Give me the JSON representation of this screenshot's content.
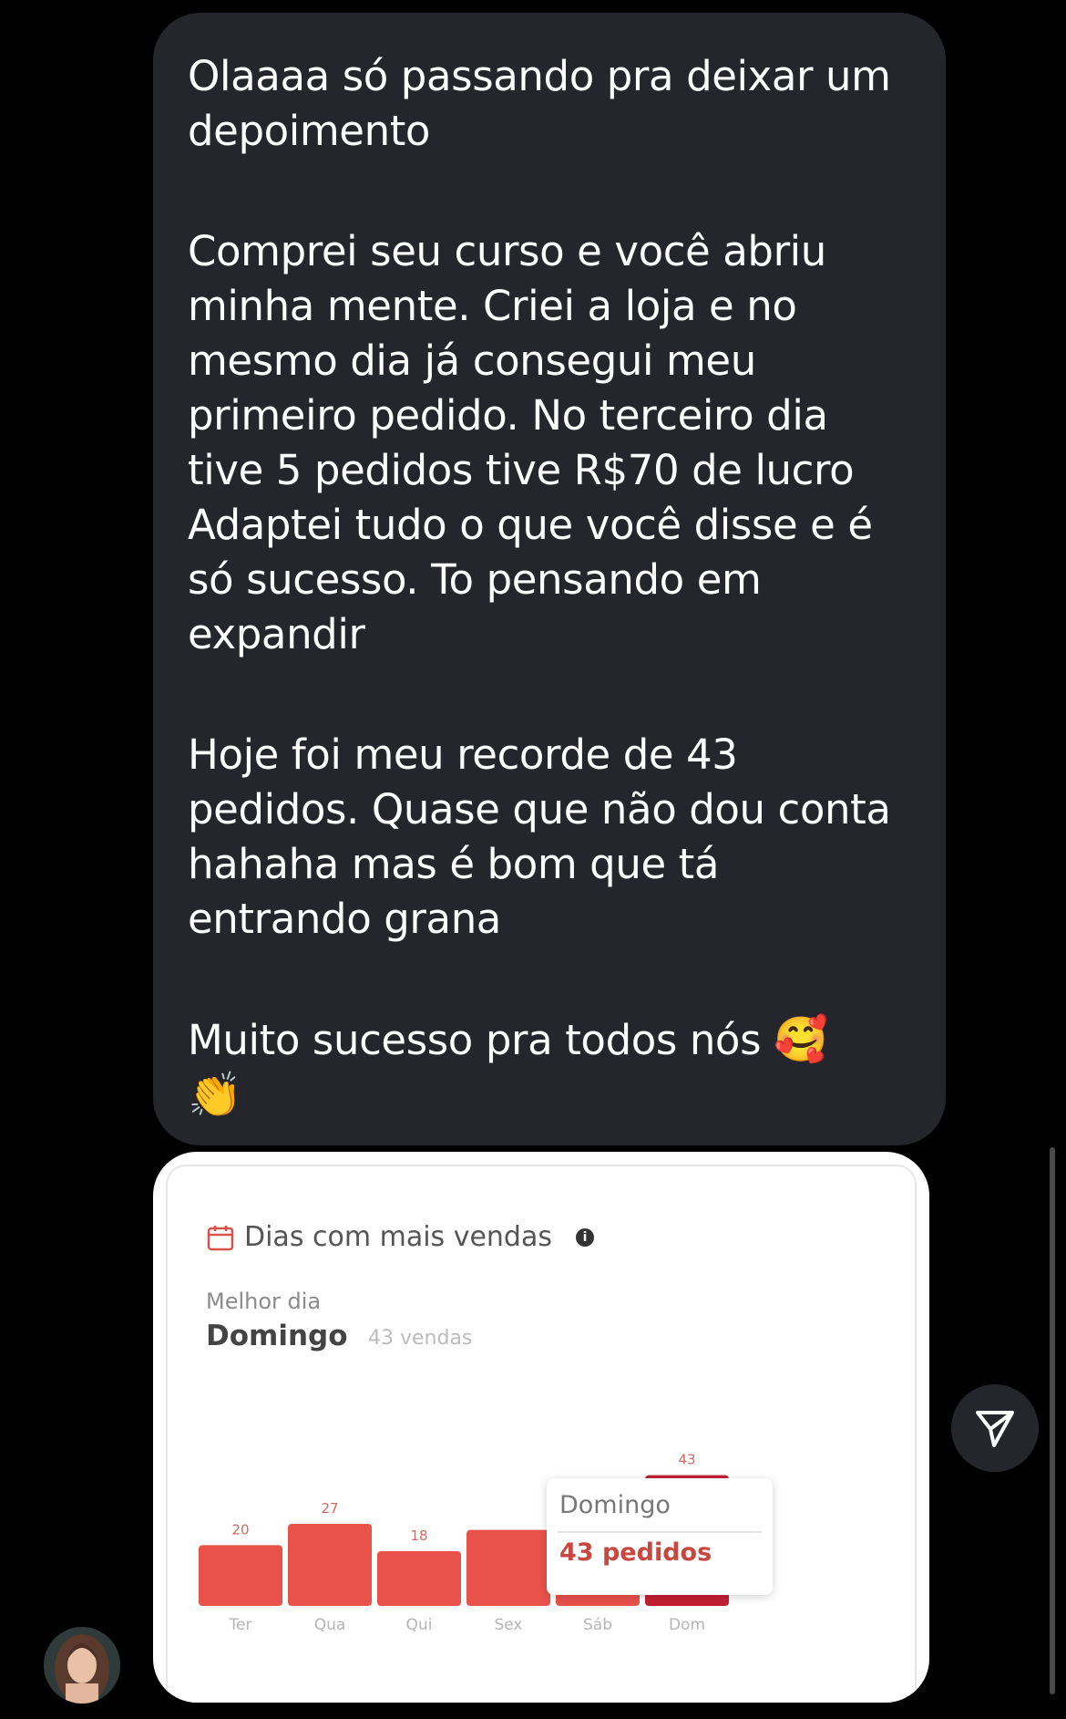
{
  "message": {
    "paragraphs": [
      "Olaaaa só passando pra deixar um\ndepoimento",
      "Comprei seu curso e você abriu\nminha mente. Criei a loja e no\nmesmo dia já consegui meu\nprimeiro pedido. No terceiro dia\ntive 5 pedidos tive R$70 de lucro\nAdaptei tudo o que você disse e é\nsó sucesso. To pensando em\nexpandir",
      "Hoje foi meu recorde de 43\npedidos. Quase que não dou conta\nhahaha mas é bom que tá\nentrando grana",
      "Muito sucesso pra todos nós"
    ],
    "emoji_1": "🥰",
    "emoji_2": "👏"
  },
  "attachment": {
    "title": "Dias com mais vendas",
    "best_label": "Melhor dia",
    "best_day": "Domingo",
    "best_sales": "43 vendas",
    "tooltip": {
      "day": "Domingo",
      "value": "43 pedidos"
    }
  },
  "chart_data": {
    "type": "bar",
    "categories": [
      "Ter",
      "Qua",
      "Qui",
      "Sex",
      "Sáb",
      "Dom"
    ],
    "values": [
      20,
      27,
      18,
      25,
      18,
      43
    ],
    "data_labels": [
      "20",
      "27",
      "18",
      "",
      "",
      "43"
    ],
    "highlight_color": "#c41f33",
    "bar_color": "#e8524a",
    "ylim": [
      0,
      45
    ]
  },
  "icons": {
    "send": "send-icon",
    "calendar": "calendar-icon",
    "info": "info-icon"
  }
}
